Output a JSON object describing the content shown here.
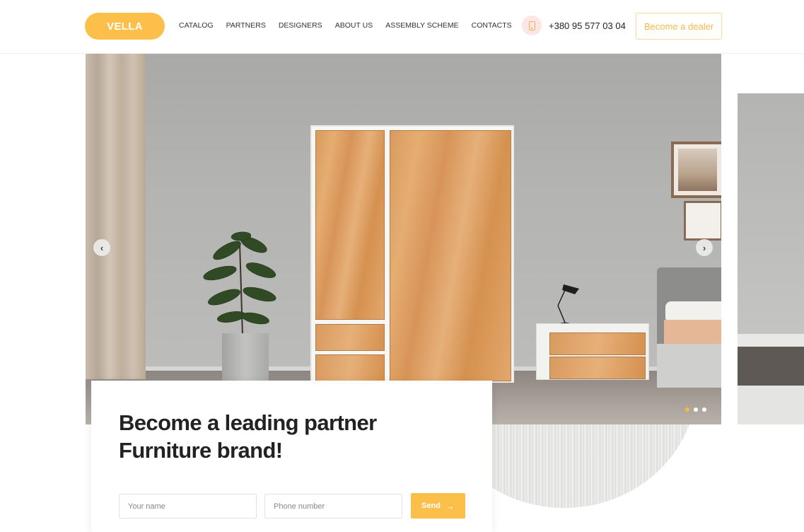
{
  "header": {
    "logo": "VELLA",
    "nav": [
      "CATALOG",
      "PARTNERS",
      "DESIGNERS",
      "ABOUT US",
      "ASSEMBLY SCHEME",
      "CONTACTS"
    ],
    "phone": "+380 95 577 03 04",
    "dealer_button": "Become a dealer"
  },
  "slider": {
    "prev_arrow": "‹",
    "next_arrow": "›",
    "dots_count": 3,
    "active_dot": 0
  },
  "form": {
    "headline_line1": "Become a leading partner",
    "headline_line2": "Furniture brand!",
    "name_placeholder": "Your name",
    "phone_placeholder": "Phone number",
    "send_label": "Send",
    "send_arrow": "→"
  },
  "colors": {
    "accent": "#fcbf4a",
    "accent_text": "#f6b948",
    "phone_icon_bg": "#fde6e6"
  }
}
